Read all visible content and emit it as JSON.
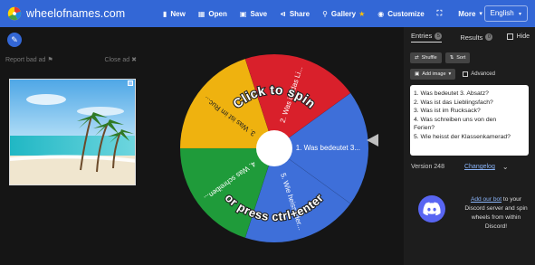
{
  "app": {
    "title": "wheelofnames.com"
  },
  "menu": [
    {
      "icon": "file-icon",
      "label": "New"
    },
    {
      "icon": "folder-open-icon",
      "label": "Open"
    },
    {
      "icon": "save-icon",
      "label": "Save"
    },
    {
      "icon": "share-icon",
      "label": "Share"
    },
    {
      "icon": "search-icon",
      "label": "Gallery"
    },
    {
      "icon": "palette-icon",
      "label": "Customize"
    },
    {
      "icon": "fullscreen-icon",
      "label": ""
    },
    {
      "icon": "chevron-down-icon",
      "label": "More"
    }
  ],
  "language": "English",
  "ad": {
    "report": "Report bad ad",
    "close": "Close ad"
  },
  "wheel": {
    "center_text_1": "Click to spin",
    "center_text_2": "or press ctrl+enter",
    "segments": [
      {
        "label": "1. Was bedeutet 3...",
        "color": "#3e6fd9"
      },
      {
        "label": "5. Wie heisst der...",
        "color": "#3e6fd9"
      },
      {
        "label": "4. Was schreiben...",
        "color": "#1f9b3a"
      },
      {
        "label": "3. Was ist im Ruc...",
        "color": "#efb20f"
      },
      {
        "label": "2. Was ist das Li...",
        "color": "#d9202b"
      }
    ]
  },
  "tabs": {
    "entries_label": "Entries",
    "entries_count": "5",
    "results_label": "Results",
    "results_count": "0",
    "hide_label": "Hide"
  },
  "toolbar": {
    "shuffle": "Shuffle",
    "sort": "Sort",
    "add_image": "Add image",
    "advanced": "Advanced"
  },
  "entries": [
    "1. Was bedeutet 3. Absatz?",
    "2. Was ist das Lieblingsfach?",
    "3. Was ist im Rucksack?",
    "4. Was schreiben uns von den",
    "Ferien?",
    "5. Wie heisst der Klassenkamerad?"
  ],
  "version": {
    "label": "Version 248",
    "changelog": "Changelog"
  },
  "discord": {
    "link_text": "Add our bot",
    "text": "to your Discord server and spin wheels from within Discord!"
  }
}
